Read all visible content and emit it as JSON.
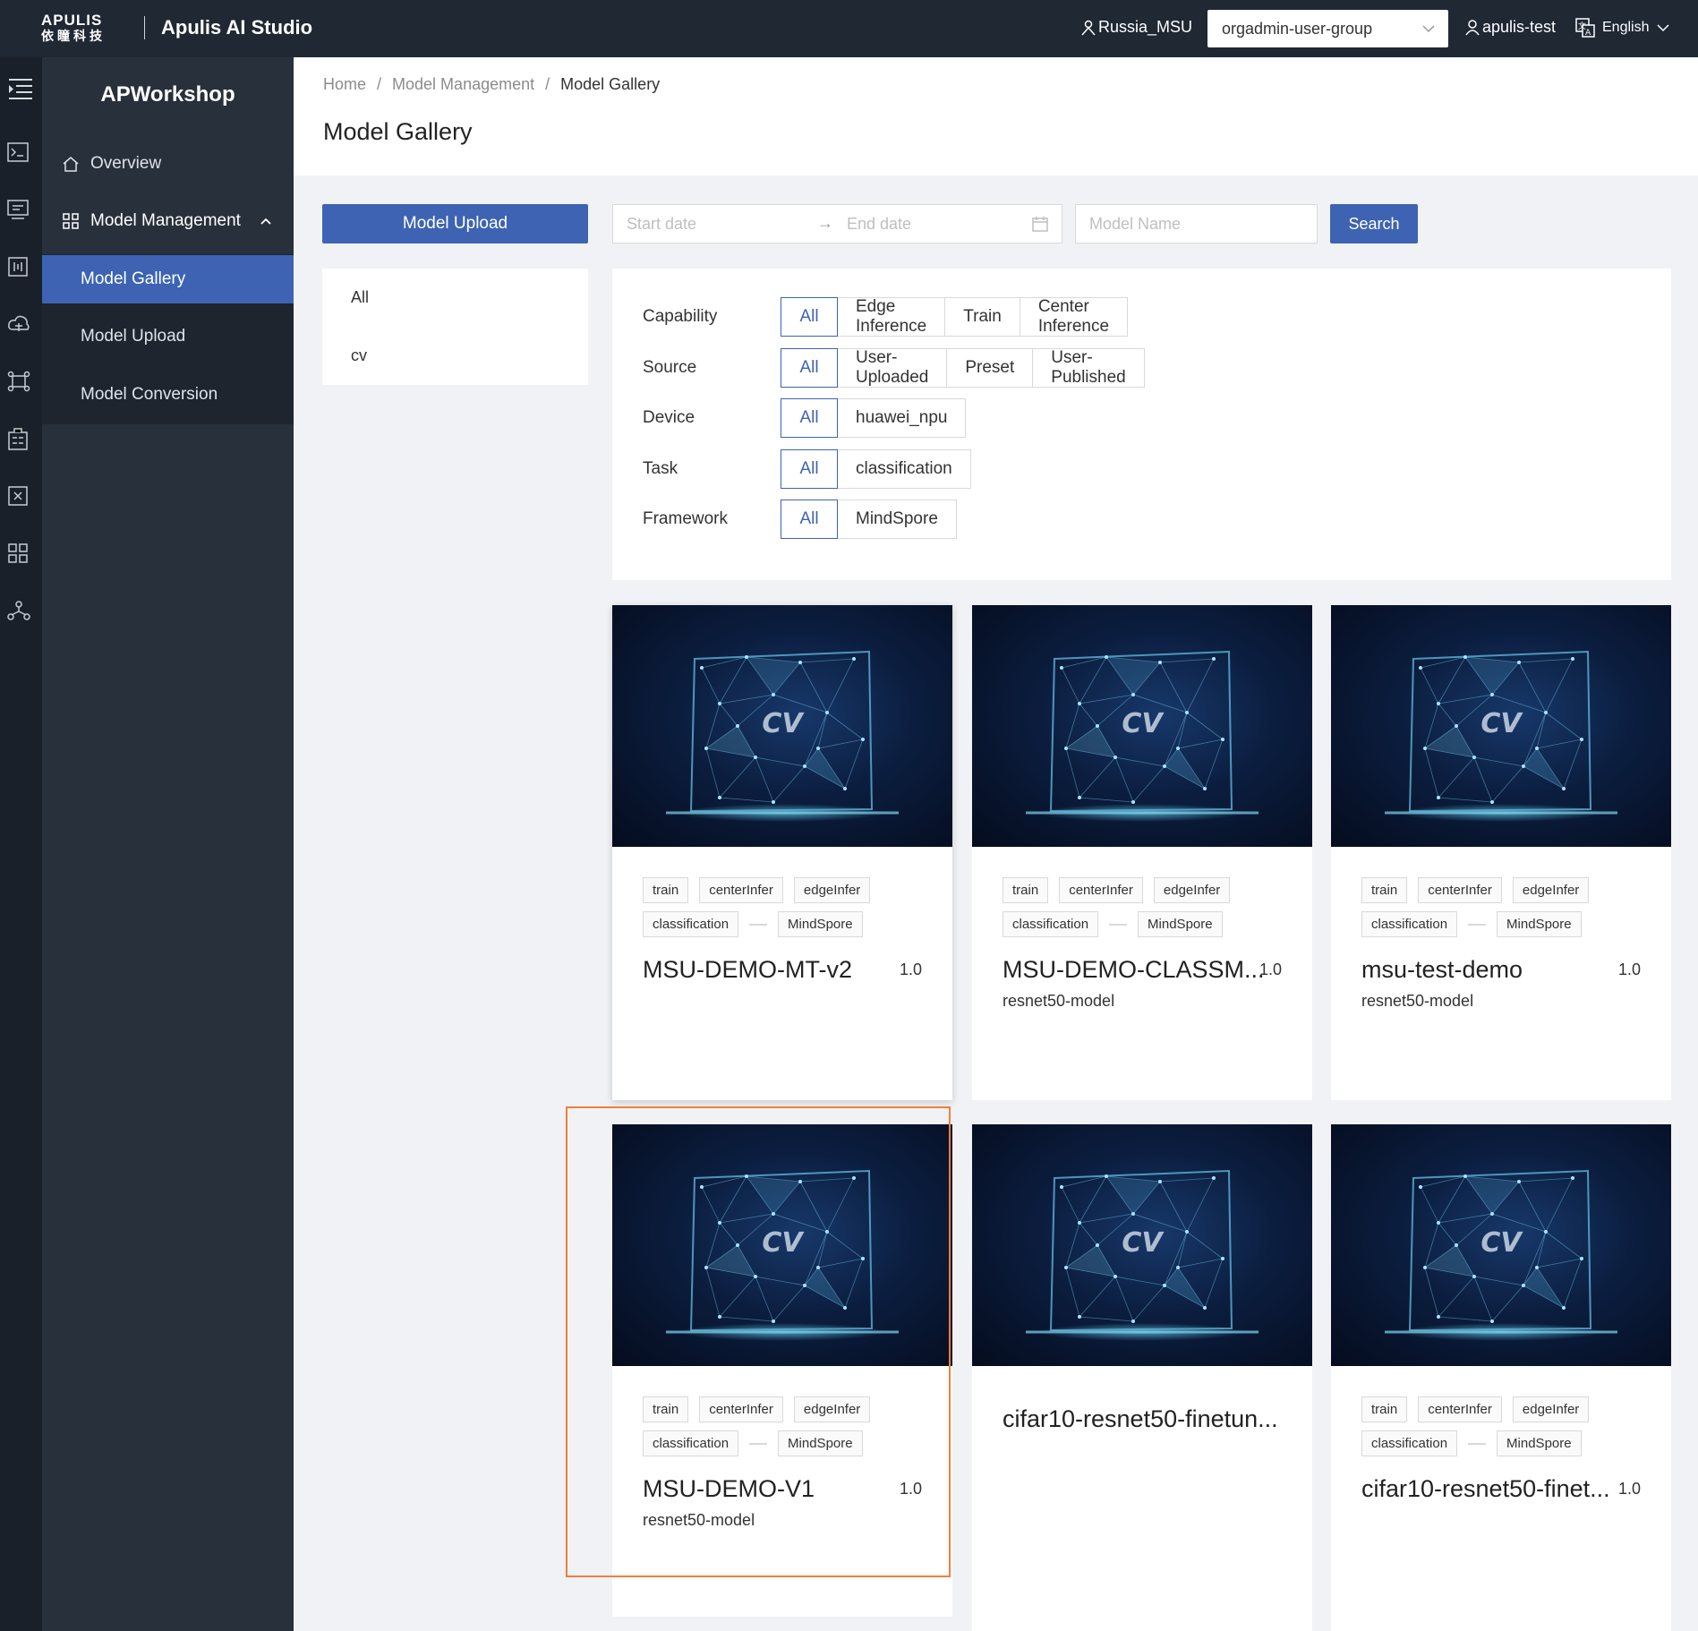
{
  "topbar": {
    "logo_top": "APULIS",
    "logo_bottom": "依瞳科技",
    "app_name": "Apulis AI Studio",
    "org": "Russia_MSU",
    "group": "orgadmin-user-group",
    "user": "apulis-test",
    "language": "English"
  },
  "rail_icons": [
    "menu-icon",
    "terminal-icon",
    "code-icon",
    "dataset-icon",
    "cloud-icon",
    "model-icon",
    "apps-icon",
    "command-icon",
    "layout-icon",
    "network-icon"
  ],
  "sidebar": {
    "title": "APWorkshop",
    "overview": "Overview",
    "model_management": "Model Management",
    "sub": [
      "Model Gallery",
      "Model Upload",
      "Model Conversion"
    ]
  },
  "breadcrumb": [
    "Home",
    "/",
    "Model Management",
    "/",
    "Model Gallery"
  ],
  "page_title": "Model Gallery",
  "toolbar": {
    "upload_label": "Model Upload",
    "start_placeholder": "Start date",
    "arrow": "→",
    "end_placeholder": "End date",
    "name_placeholder": "Model Name",
    "search_label": "Search"
  },
  "categories": [
    "All",
    "cv"
  ],
  "filters": [
    {
      "label": "Capability",
      "options": [
        "All",
        "Edge Inference",
        "Train",
        "Center Inference"
      ]
    },
    {
      "label": "Source",
      "options": [
        "All",
        "User-Uploaded",
        "Preset",
        "User-Published"
      ]
    },
    {
      "label": "Device",
      "options": [
        "All",
        "huawei_npu"
      ]
    },
    {
      "label": "Task",
      "options": [
        "All",
        "classification"
      ]
    },
    {
      "label": "Framework",
      "options": [
        "All",
        "MindSpore"
      ]
    }
  ],
  "thumb_text": "CV",
  "cards": [
    {
      "name": "MSU-DEMO-MT-v2",
      "version": "1.0",
      "desc": "",
      "tags_row1": [
        "train",
        "centerInfer",
        "edgeInfer"
      ],
      "tags_row2": [
        "classification",
        "MindSpore"
      ]
    },
    {
      "name": "MSU-DEMO-CLASSM...",
      "version": "1.0",
      "desc": "resnet50-model",
      "tags_row1": [
        "train",
        "centerInfer",
        "edgeInfer"
      ],
      "tags_row2": [
        "classification",
        "MindSpore"
      ]
    },
    {
      "name": "msu-test-demo",
      "version": "1.0",
      "desc": "resnet50-model",
      "tags_row1": [
        "train",
        "centerInfer",
        "edgeInfer"
      ],
      "tags_row2": [
        "classification",
        "MindSpore"
      ]
    },
    {
      "name": "MSU-DEMO-V1",
      "version": "1.0",
      "desc": "resnet50-model",
      "tags_row1": [
        "train",
        "centerInfer",
        "edgeInfer"
      ],
      "tags_row2": [
        "classification",
        "MindSpore"
      ]
    },
    {
      "name": "cifar10-resnet50-finetun...",
      "version": "",
      "desc": "",
      "tags_row1": [],
      "tags_row2": []
    },
    {
      "name": "cifar10-resnet50-finet...",
      "version": "1.0",
      "desc": "",
      "tags_row1": [
        "train",
        "centerInfer",
        "edgeInfer"
      ],
      "tags_row2": [
        "classification",
        "MindSpore"
      ]
    }
  ],
  "colors": {
    "primary": "#3d63b2",
    "topbar": "#1f2833",
    "sidebar": "#28303b",
    "highlight": "#f07f3a"
  }
}
